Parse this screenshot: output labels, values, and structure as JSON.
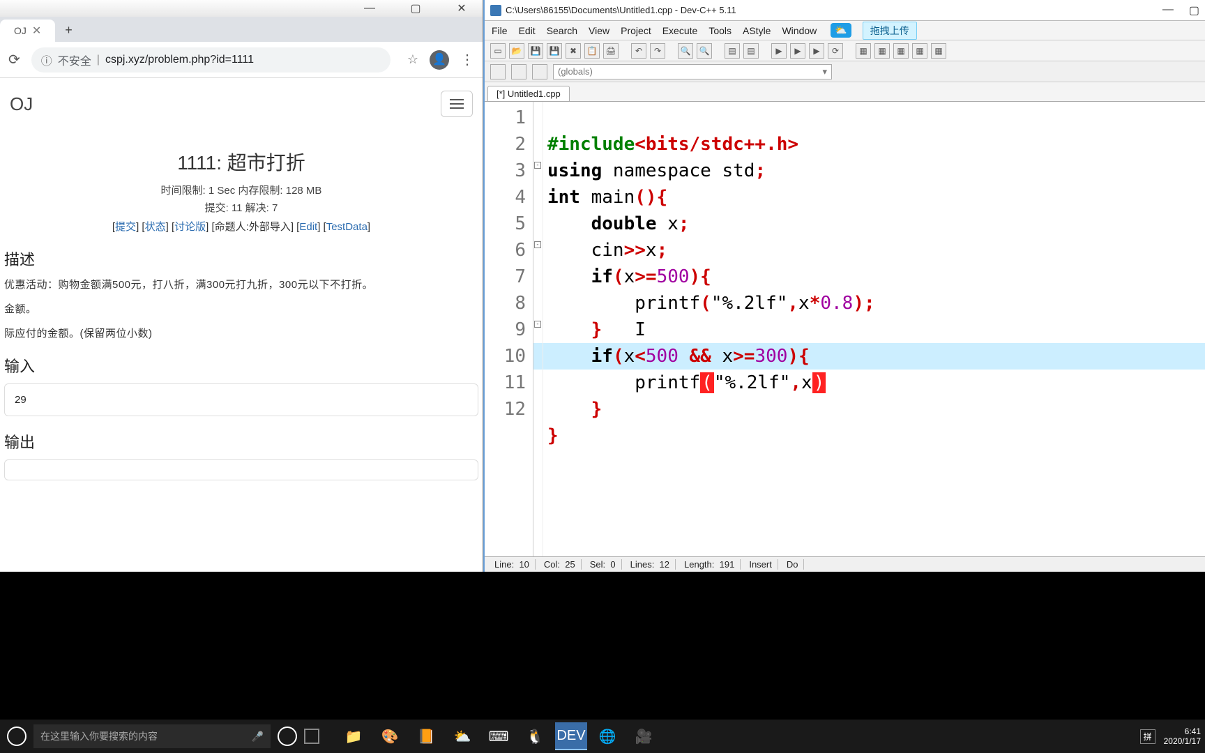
{
  "browser": {
    "tab_title": "OJ",
    "win_minimize": "—",
    "win_maximize": "▢",
    "win_close": "✕",
    "tab_close": "✕",
    "new_tab": "+",
    "reload": "⟳",
    "info": "ⓘ",
    "not_secure": "不安全",
    "url_sep": "|",
    "url": "cspj.xyz/problem.php?id=1111",
    "star": "☆",
    "user": "👤",
    "kebab": "⋮",
    "oj_brand": "OJ",
    "problem_title": "1111: 超市打折",
    "limits": "时间限制: 1 Sec  内存限制: 128 MB",
    "stats": "提交: 11  解决: 7",
    "links": {
      "open": "[",
      "close": "]",
      "submit": "提交",
      "status": "状态",
      "discuss": "讨论版",
      "meta": "命题人:外部导入",
      "edit": "Edit",
      "testdata": "TestData"
    },
    "sect_desc": "描述",
    "desc_text": "优惠活动：购物金额满500元，打八折，满300元打九折，300元以下不打折。",
    "amount_text": "金额。",
    "output_note": "际应付的金额。(保留两位小数)",
    "sect_input": "输入",
    "sample_in": "29",
    "sect_output": "输出",
    "sample_out_prefix": ""
  },
  "devcpp": {
    "icon_title": "",
    "title": "C:\\Users\\86155\\Documents\\Untitled1.cpp - Dev-C++ 5.11",
    "win_minimize": "—",
    "win_maximize": "▢",
    "win_close": "✕",
    "menu": [
      "File",
      "Edit",
      "Search",
      "View",
      "Project",
      "Execute",
      "Tools",
      "AStyle",
      "Window"
    ],
    "cloud": "⛅",
    "upload": "拖拽上传",
    "globals": "(globals)",
    "globals_arrow": "▾",
    "file_tab": "[*] Untitled1.cpp",
    "gutter": [
      "1",
      "2",
      "3",
      "4",
      "5",
      "6",
      "7",
      "8",
      "9",
      "10",
      "11",
      "12"
    ],
    "code": {
      "l1_a": "#include",
      "l1_b": "<bits/stdc++.h>",
      "l2_a": "using",
      "l2_b": " namespace std",
      "l3_a": "int",
      "l3_b": " main",
      "l3_c": "(){",
      "l4_a": "double",
      "l4_b": " x",
      "l5_a": "cin",
      "l5_b": ">>",
      "l5_c": "x",
      "l6_a": "if",
      "l6_b": "(",
      "l6_c": "x",
      "l6_d": ">=",
      "l6_e": "500",
      "l6_f": "){",
      "l7_a": "printf",
      "l7_b": "(",
      "l7_c": "\"%.2lf\"",
      "l7_d": ",",
      "l7_e": "x",
      "l7_f": "*",
      "l7_g": "0.8",
      "l7_h": ");",
      "l8_a": "}",
      "l9_a": "if",
      "l9_b": "(",
      "l9_c": "x",
      "l9_d": "<",
      "l9_e": "500",
      "l9_f": " && ",
      "l9_g": "x",
      "l9_h": ">=",
      "l9_i": "300",
      "l9_j": "){",
      "l10_a": "printf",
      "l10_b": "(",
      "l10_c": "\"%.2lf\"",
      "l10_d": ",",
      "l10_e": "x",
      "l10_f": ")",
      "l11_a": "}",
      "l12_a": "}"
    },
    "status": {
      "line_lbl": "Line:",
      "line_val": "10",
      "col_lbl": "Col:",
      "col_val": "25",
      "sel_lbl": "Sel:",
      "sel_val": "0",
      "lines_lbl": "Lines:",
      "lines_val": "12",
      "len_lbl": "Length:",
      "len_val": "191",
      "insert": "Insert",
      "done": "Do"
    }
  },
  "taskbar": {
    "search_placeholder": "在这里输入你要搜索的内容",
    "mic": "🎤",
    "apps": [
      "📁",
      "🎨",
      "📙",
      "⛅",
      "⌨",
      "🐧",
      "DEV",
      "🌐",
      "🎥"
    ],
    "active_index": 6,
    "ime": "拼",
    "time": "6:41",
    "date": "2020/1/17"
  }
}
